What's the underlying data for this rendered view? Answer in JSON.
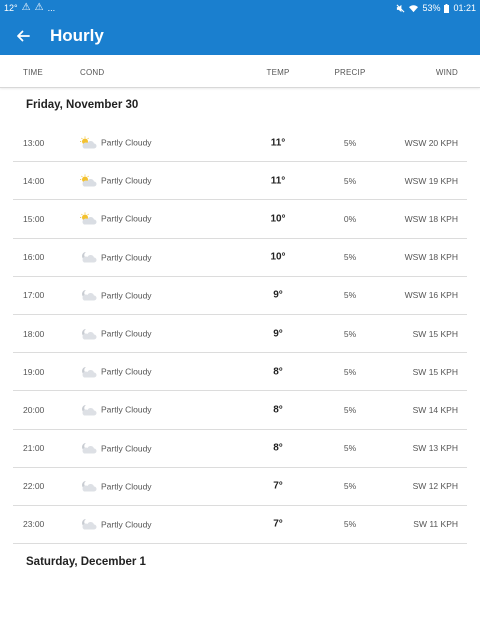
{
  "status": {
    "temp": "12°",
    "warn1": "⚠",
    "warn2": "⚠",
    "more": "...",
    "battery": "53%",
    "time": "01:21"
  },
  "appbar": {
    "title": "Hourly"
  },
  "columns": {
    "time": "TIME",
    "cond": "COND",
    "temp": "TEMP",
    "precip": "PRECIP",
    "wind": "WIND"
  },
  "days": [
    {
      "label": "Friday, November 30"
    },
    {
      "label": "Saturday, December 1"
    }
  ],
  "rows": [
    {
      "time": "13:00",
      "icon": "partly-cloudy-day-icon",
      "cond": "Partly Cloudy",
      "temp": "11°",
      "precip": "5%",
      "wind": "WSW 20 KPH"
    },
    {
      "time": "14:00",
      "icon": "partly-cloudy-day-icon",
      "cond": "Partly Cloudy",
      "temp": "11°",
      "precip": "5%",
      "wind": "WSW 19 KPH"
    },
    {
      "time": "15:00",
      "icon": "partly-cloudy-day-icon",
      "cond": "Partly Cloudy",
      "temp": "10°",
      "precip": "0%",
      "wind": "WSW 18 KPH"
    },
    {
      "time": "16:00",
      "icon": "partly-cloudy-night-icon",
      "cond": "Partly Cloudy",
      "temp": "10°",
      "precip": "5%",
      "wind": "WSW 18 KPH"
    },
    {
      "time": "17:00",
      "icon": "partly-cloudy-night-icon",
      "cond": "Partly Cloudy",
      "temp": "9°",
      "precip": "5%",
      "wind": "WSW 16 KPH"
    },
    {
      "time": "18:00",
      "icon": "partly-cloudy-night-icon",
      "cond": "Partly Cloudy",
      "temp": "9°",
      "precip": "5%",
      "wind": "SW 15 KPH"
    },
    {
      "time": "19:00",
      "icon": "partly-cloudy-night-icon",
      "cond": "Partly Cloudy",
      "temp": "8°",
      "precip": "5%",
      "wind": "SW 15 KPH"
    },
    {
      "time": "20:00",
      "icon": "partly-cloudy-night-icon",
      "cond": "Partly Cloudy",
      "temp": "8°",
      "precip": "5%",
      "wind": "SW 14 KPH"
    },
    {
      "time": "21:00",
      "icon": "partly-cloudy-night-icon",
      "cond": "Partly Cloudy",
      "temp": "8°",
      "precip": "5%",
      "wind": "SW 13 KPH"
    },
    {
      "time": "22:00",
      "icon": "partly-cloudy-night-icon",
      "cond": "Partly Cloudy",
      "temp": "7°",
      "precip": "5%",
      "wind": "SW 12 KPH"
    },
    {
      "time": "23:00",
      "icon": "partly-cloudy-night-icon",
      "cond": "Partly Cloudy",
      "temp": "7°",
      "precip": "5%",
      "wind": "SW 11 KPH"
    }
  ]
}
